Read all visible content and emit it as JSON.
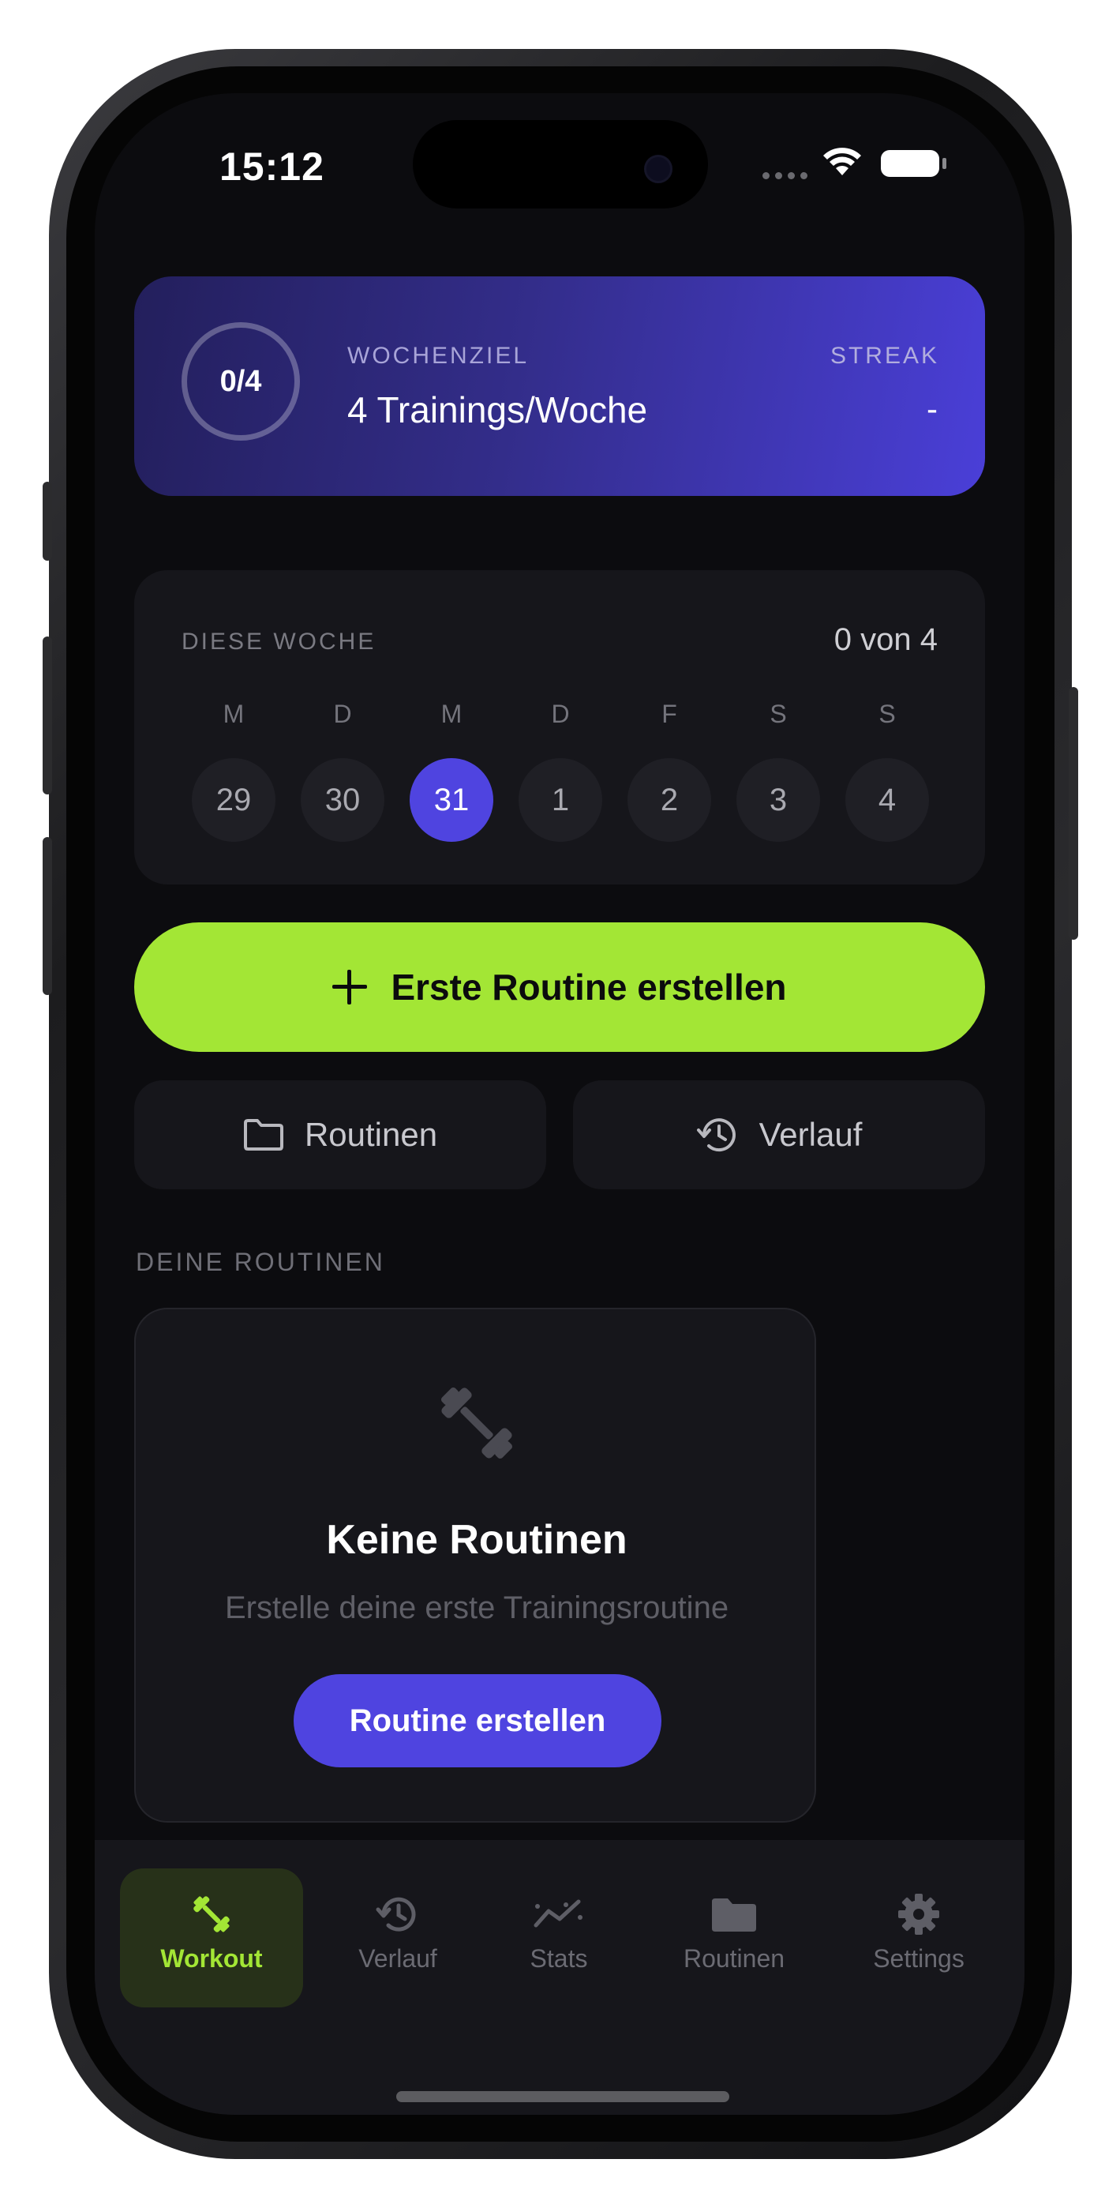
{
  "status_bar": {
    "time": "15:12"
  },
  "goal_card": {
    "progress_text": "0/4",
    "progress_fraction": 0.0,
    "label": "WOCHENZIEL",
    "title": "4 Trainings/Woche",
    "streak_label": "STREAK",
    "streak_value": "-"
  },
  "week": {
    "label": "DIESE WOCHE",
    "count": "0 von 4",
    "days": [
      {
        "letter": "M",
        "num": "29"
      },
      {
        "letter": "D",
        "num": "30"
      },
      {
        "letter": "M",
        "num": "31"
      },
      {
        "letter": "D",
        "num": "1"
      },
      {
        "letter": "F",
        "num": "2"
      },
      {
        "letter": "S",
        "num": "3"
      },
      {
        "letter": "S",
        "num": "4"
      }
    ],
    "active_day": "31"
  },
  "actions": {
    "create_routine": "Erste Routine erstellen",
    "routines": "Routinen",
    "history": "Verlauf"
  },
  "routines_section": {
    "label": "DEINE ROUTINEN",
    "empty_title": "Keine Routinen",
    "empty_subtitle": "Erstelle deine erste Trainingsroutine",
    "empty_button": "Routine erstellen"
  },
  "tab_bar": {
    "tabs": [
      {
        "label": "Workout",
        "icon": "dumbbell-icon",
        "active": true
      },
      {
        "label": "Verlauf",
        "icon": "history-icon",
        "active": false
      },
      {
        "label": "Stats",
        "icon": "stats-icon",
        "active": false
      },
      {
        "label": "Routinen",
        "icon": "folder-icon",
        "active": false
      },
      {
        "label": "Settings",
        "icon": "gear-icon",
        "active": false
      }
    ]
  },
  "colors": {
    "accent_green": "#a3e635",
    "accent_purple": "#4f44e0",
    "background": "#0c0c0f",
    "card": "#16161b"
  }
}
